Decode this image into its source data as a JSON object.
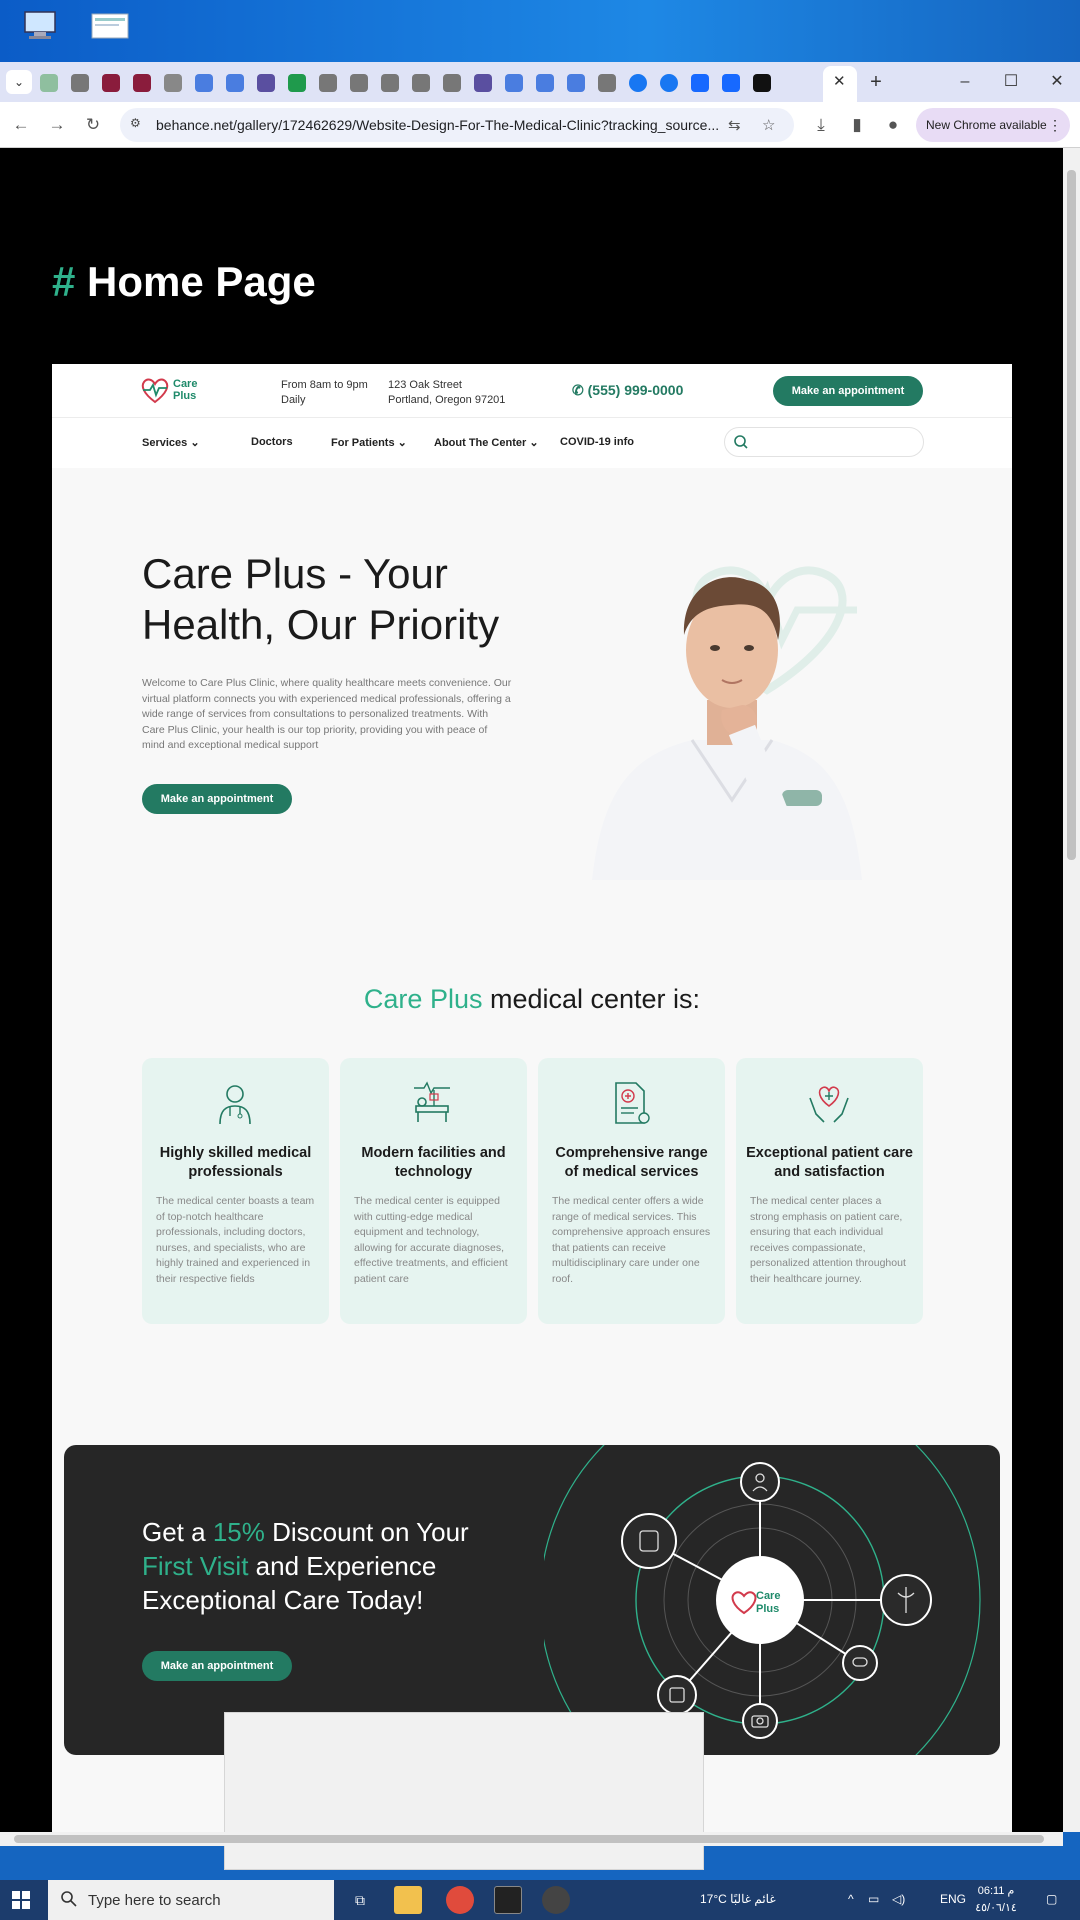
{
  "browser": {
    "url": "behance.net/gallery/172462629/Website-Design-For-The-Medical-Clinic?tracking_source...",
    "new_chrome": "New Chrome available"
  },
  "page": {
    "section_hash": "#",
    "section_title": "Home Page"
  },
  "site": {
    "logo_line1": "Care",
    "logo_line2": "Plus",
    "hours_line1": "From 8am to 9pm",
    "hours_line2": "Daily",
    "address_line1": "123 Oak Street",
    "address_line2": "Portland, Oregon 97201",
    "phone": "(555) 999-0000",
    "appointment_label": "Make an appointment",
    "nav": {
      "services": "Services",
      "doctors": "Doctors",
      "for_patients": "For Patients",
      "about": "About The Center",
      "covid": "COVID-19 info"
    },
    "hero": {
      "title": "Care Plus - Your Health, Our Priority",
      "text": "Welcome to Care Plus Clinic, where quality healthcare meets convenience. Our virtual platform connects you with experienced medical professionals, offering a wide range of services from consultations to personalized treatments. With Care Plus Clinic, your health is our top priority, providing you with peace of mind and exceptional medical support",
      "button": "Make an appointment"
    },
    "center": {
      "title_accent": "Care Plus",
      "title_rest": " medical center is:"
    },
    "cards": [
      {
        "title": "Highly skilled medical professionals",
        "text": "The medical center boasts a team of top-notch healthcare professionals, including doctors, nurses, and specialists, who are highly trained and experienced in their respective fields",
        "icon": "doctor-icon"
      },
      {
        "title": "Modern facilities and technology",
        "text": "The medical center is equipped with cutting-edge medical equipment and technology, allowing for accurate diagnoses, effective treatments, and efficient patient care",
        "icon": "hospital-bed-icon"
      },
      {
        "title": "Comprehensive range of medical services",
        "text": "The medical center offers a wide range of medical services. This comprehensive approach ensures that patients can receive multidisciplinary care under one roof.",
        "icon": "medical-report-icon"
      },
      {
        "title": "Exceptional patient care and satisfaction",
        "text": "The medical center places a strong emphasis on patient care, ensuring that each individual receives compassionate, personalized attention throughout their healthcare journey.",
        "icon": "care-hands-icon"
      }
    ],
    "promo": {
      "t1": "Get a ",
      "t2": "15%",
      "t3": " Discount on Your ",
      "t4": "First Visit",
      "t5": " and Experience Exceptional Care Today!",
      "button": "Make an appointment",
      "logo_line1": "Care",
      "logo_line2": "Plus"
    }
  },
  "taskbar": {
    "search_placeholder": "Type here to search",
    "weather": "17°C  غائم غالبًا",
    "language": "ENG",
    "time": "06:11 م",
    "date": "٤٥/٠٦/١٤"
  },
  "colors": {
    "accent": "#2fb18b",
    "button": "#237a62",
    "brand_heart": "#d23a4c"
  }
}
